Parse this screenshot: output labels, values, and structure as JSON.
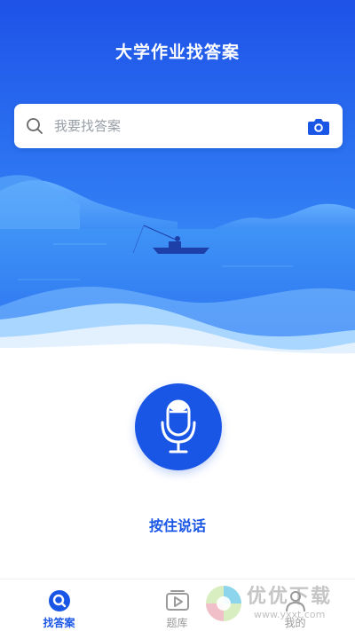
{
  "header": {
    "title": "大学作业找答案"
  },
  "search": {
    "placeholder": "我要找答案"
  },
  "voice": {
    "label": "按住说话"
  },
  "tabs": [
    {
      "label": "找答案",
      "icon": "search-icon",
      "active": true
    },
    {
      "label": "题库",
      "icon": "play-box-icon",
      "active": false
    },
    {
      "label": "我的",
      "icon": "user-icon",
      "active": false
    }
  ],
  "watermark": {
    "text": "优优下载",
    "url": "www.yxxt.com"
  },
  "colors": {
    "accent": "#1a56e6",
    "inactive": "#9a9a9a"
  }
}
